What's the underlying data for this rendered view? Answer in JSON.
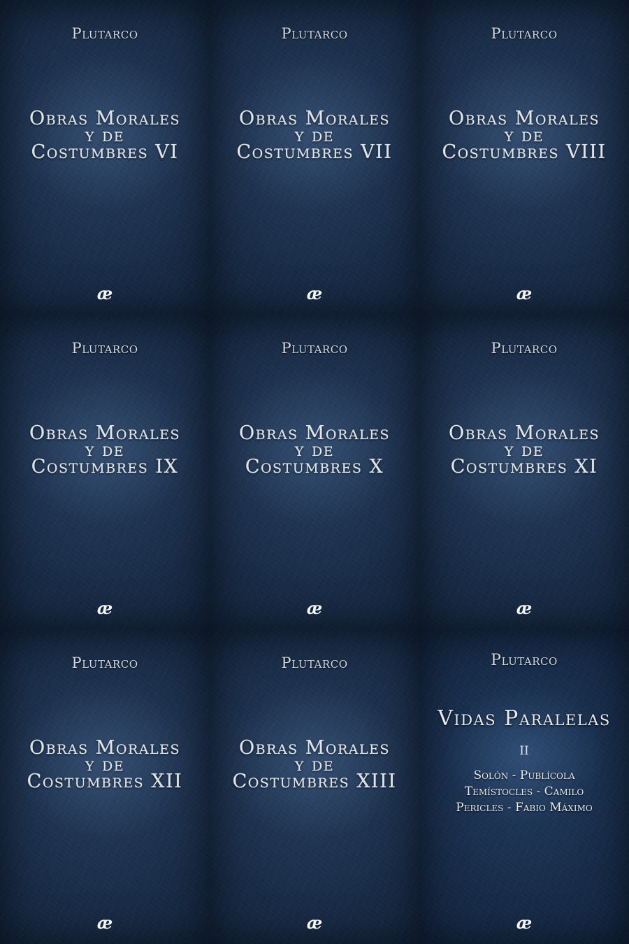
{
  "covers": [
    {
      "author": "Plutarco",
      "title_line1": "Obras Morales",
      "title_line2": "y de",
      "title_line3": "Costumbres VI",
      "logo": "ae-ligature-icon"
    },
    {
      "author": "Plutarco",
      "title_line1": "Obras Morales",
      "title_line2": "y de",
      "title_line3": "Costumbres VII",
      "logo": "ae-ligature-icon"
    },
    {
      "author": "Plutarco",
      "title_line1": "Obras Morales",
      "title_line2": "y de",
      "title_line3": "Costumbres VIII",
      "logo": "ae-ligature-icon"
    },
    {
      "author": "Plutarco",
      "title_line1": "Obras Morales",
      "title_line2": "y de",
      "title_line3": "Costumbres IX",
      "logo": "ae-ligature-icon"
    },
    {
      "author": "Plutarco",
      "title_line1": "Obras Morales",
      "title_line2": "y de",
      "title_line3": "Costumbres X",
      "logo": "ae-ligature-icon"
    },
    {
      "author": "Plutarco",
      "title_line1": "Obras Morales",
      "title_line2": "y de",
      "title_line3": "Costumbres XI",
      "logo": "ae-ligature-icon"
    },
    {
      "author": "Plutarco",
      "title_line1": "Obras Morales",
      "title_line2": "y de",
      "title_line3": "Costumbres XII",
      "logo": "ae-ligature-icon"
    },
    {
      "author": "Plutarco",
      "title_line1": "Obras Morales",
      "title_line2": "y de",
      "title_line3": "Costumbres XIII",
      "logo": "ae-ligature-icon"
    }
  ],
  "vidas": {
    "author": "Plutarco",
    "title": "Vidas Paralelas",
    "volume": "II",
    "lines": [
      "Solón - Publícola",
      "Temístocles - Camilo",
      "Pericles - Fabio Máximo"
    ],
    "logo": "ae-ligature-icon"
  },
  "colors": {
    "leather": "#15263f",
    "text": "#dfe4ea"
  }
}
